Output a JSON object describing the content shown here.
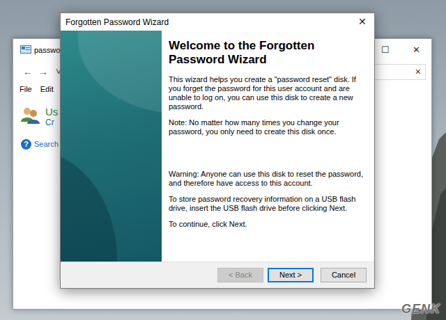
{
  "background_window": {
    "title": "passwor",
    "controls": [
      "☐",
      "✕"
    ],
    "nav": [
      "←",
      "→",
      "˅"
    ],
    "search_clear": "×",
    "menu": [
      "File",
      "Edit"
    ],
    "heading": "Us",
    "subheading": "Cr",
    "help_icon": "?",
    "help": "Search V"
  },
  "dialog": {
    "title": "Forgotten Password Wizard",
    "close": "✕",
    "heading": "Welcome to the Forgotten Password Wizard",
    "paragraphs": [
      "This wizard helps you create a \"password reset\" disk. If you forget the password for this user account and are unable to log on, you can use this disk to create a new password.",
      "Note: No matter how many times you change your password, you only need to create this disk once.",
      "Warning: Anyone can use this disk to reset the password, and therefore have access to this account.",
      "To store password recovery information on a USB flash drive, insert the USB flash drive before clicking Next.",
      "To continue, click Next."
    ],
    "buttons": [
      {
        "label": "< Back",
        "disabled": true,
        "selected": false
      },
      {
        "label": "Next >",
        "disabled": false,
        "selected": true
      },
      {
        "label": "Cancel",
        "disabled": false,
        "selected": false
      }
    ]
  },
  "watermark": "GENK"
}
